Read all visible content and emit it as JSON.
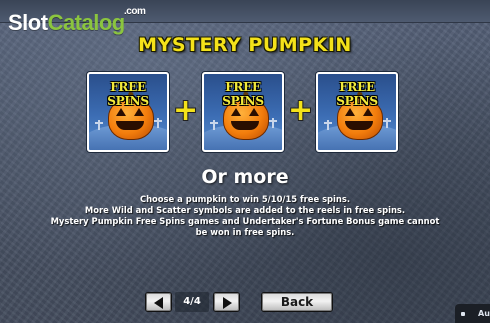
{
  "watermark": {
    "slot": "Slot",
    "catalog": "Catalog",
    "com": ".com"
  },
  "title": "MYSTERY PUMPKIN",
  "cards": [
    {
      "label": "FREE SPINS"
    },
    {
      "label": "FREE SPINS"
    },
    {
      "label": "FREE SPINS"
    }
  ],
  "plus_symbol": "+",
  "or_more": "Or more",
  "description": [
    "Choose a pumpkin to win 5/10/15 free spins.",
    "More Wild and Scatter symbols are added to the reels in free spins.",
    "Mystery Pumpkin Free Spins games and Undertaker's Fortune Bonus game cannot",
    "be won in free spins."
  ],
  "pagination": {
    "indicator": "4/4"
  },
  "back_label": "Back",
  "auto_label": "Au",
  "colors": {
    "title": "#f4e21a",
    "card_label": "#f2ea3a",
    "pumpkin": "#f37d0c",
    "logo_accent": "#8bc53f"
  }
}
